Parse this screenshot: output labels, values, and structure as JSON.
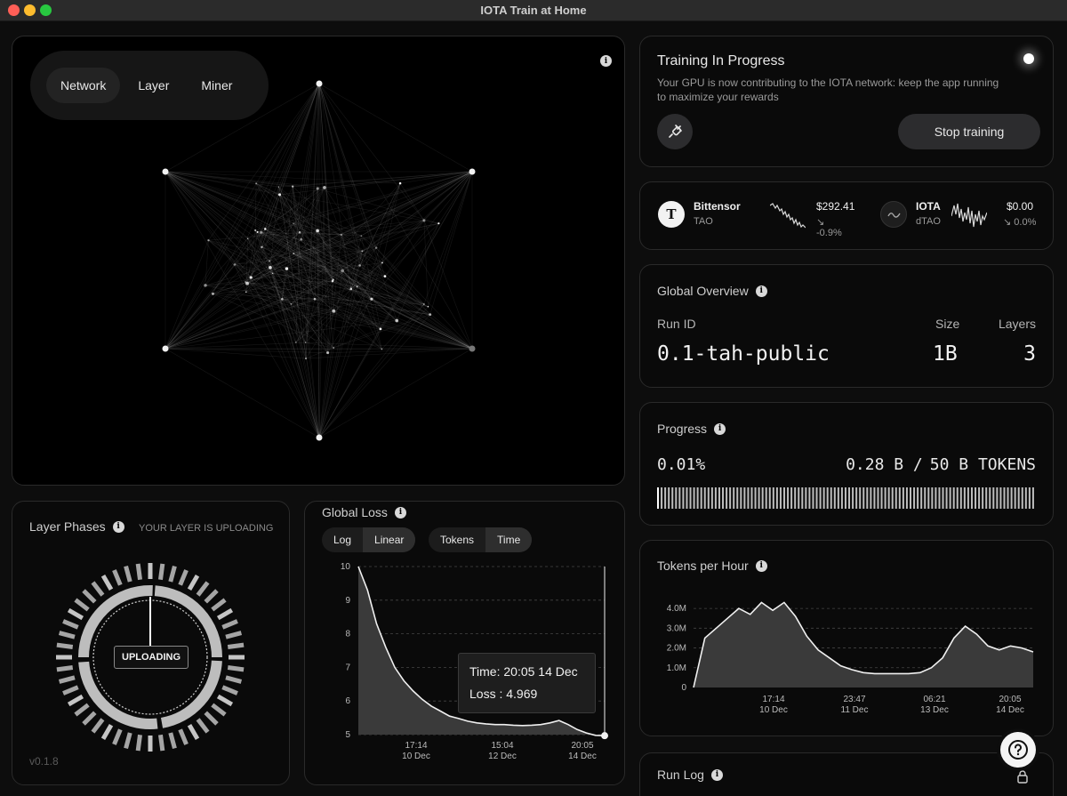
{
  "window": {
    "title": "IOTA Train at Home"
  },
  "network": {
    "tabs": [
      {
        "label": "Network",
        "active": true
      },
      {
        "label": "Layer",
        "active": false
      },
      {
        "label": "Miner",
        "active": false
      }
    ]
  },
  "training": {
    "title": "Training In Progress",
    "subtitle_line1": "Your GPU is now contributing to the IOTA network: keep the app running",
    "subtitle_line2": "to maximize your rewards",
    "stop_label": "Stop training"
  },
  "tickers": [
    {
      "name": "Bittensor",
      "symbol": "TAO",
      "icon_letter": "T",
      "price": "$292.41",
      "change": "↘ -0.9%"
    },
    {
      "name": "IOTA",
      "symbol": "dTAO",
      "price": "$0.00",
      "change": "↘ 0.0%"
    }
  ],
  "overview": {
    "title": "Global Overview",
    "run_id_label": "Run ID",
    "size_label": "Size",
    "layers_label": "Layers",
    "run_id": "0.1-tah-public",
    "size": "1B",
    "layers": "3"
  },
  "progress": {
    "title": "Progress",
    "percent": "0.01%",
    "tokens_done": "0.28 B /",
    "tokens_total": "50 B TOKENS",
    "fraction": 0.0001
  },
  "tokens_per_hour": {
    "title": "Tokens per Hour",
    "y_ticks": [
      "4.0M",
      "3.0M",
      "2.0M",
      "1.0M",
      "0"
    ],
    "x_ticks": [
      {
        "time": "17:14",
        "date": "10 Dec"
      },
      {
        "time": "23:47",
        "date": "11 Dec"
      },
      {
        "time": "06:21",
        "date": "13 Dec"
      },
      {
        "time": "20:05",
        "date": "14 Dec"
      }
    ]
  },
  "run_log": {
    "title": "Run Log"
  },
  "layer_phases": {
    "title": "Layer Phases",
    "status_caption": "YOUR LAYER IS UPLOADING",
    "badge": "UPLOADING",
    "version": "v0.1.8"
  },
  "global_loss": {
    "title": "Global Loss",
    "scale_tabs": [
      {
        "label": "Log",
        "active": false
      },
      {
        "label": "Linear",
        "active": true
      }
    ],
    "axis_tabs": [
      {
        "label": "Tokens",
        "active": false
      },
      {
        "label": "Time",
        "active": true
      }
    ],
    "y_ticks": [
      "10",
      "9",
      "8",
      "7",
      "6",
      "5"
    ],
    "x_ticks": [
      {
        "time": "17:14",
        "date": "10 Dec"
      },
      {
        "time": "15:04",
        "date": "12 Dec"
      },
      {
        "time": "20:05",
        "date": "14 Dec"
      }
    ],
    "tooltip_time": "Time: 20:05 14 Dec",
    "tooltip_loss": "Loss : 4.969"
  },
  "chart_data": [
    {
      "type": "area",
      "title": "Global Loss",
      "x_ticks": [
        "17:14 10 Dec",
        "15:04 12 Dec",
        "20:05 14 Dec"
      ],
      "ylim": [
        5,
        10
      ],
      "y": [
        10,
        9.3,
        8.3,
        7.6,
        7.0,
        6.6,
        6.3,
        6.05,
        5.85,
        5.7,
        5.55,
        5.48,
        5.4,
        5.35,
        5.32,
        5.3,
        5.3,
        5.28,
        5.27,
        5.28,
        5.3,
        5.35,
        5.42,
        5.3,
        5.15,
        5.05,
        4.98,
        4.969
      ],
      "tooltip": {
        "time": "20:05 14 Dec",
        "loss": 4.969
      }
    },
    {
      "type": "area",
      "title": "Tokens per Hour",
      "x_ticks": [
        "17:14 10 Dec",
        "23:47 11 Dec",
        "06:21 13 Dec",
        "20:05 14 Dec"
      ],
      "ylim": [
        0,
        4500000
      ],
      "y": [
        0,
        2500000,
        3000000,
        3500000,
        4000000,
        3700000,
        4300000,
        3900000,
        4300000,
        3600000,
        2600000,
        1900000,
        1500000,
        1100000,
        900000,
        750000,
        700000,
        700000,
        700000,
        700000,
        750000,
        1000000,
        1500000,
        2500000,
        3100000,
        2700000,
        2100000,
        1900000,
        2100000,
        2000000,
        1800000
      ]
    }
  ]
}
